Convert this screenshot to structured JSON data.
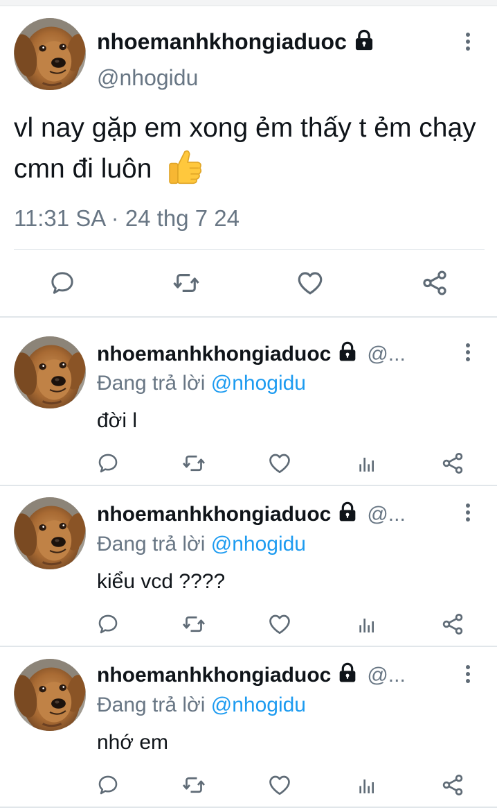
{
  "main_tweet": {
    "display_name": "nhoemanhkhongiaduoc",
    "handle": "@nhogidu",
    "text": "vl nay gặp em xong ẻm thấy t ẻm chạy cmn đi luôn",
    "emoji": "thumbs-up",
    "timestamp": "11:31 SA · 24 thg 7 24",
    "actions": [
      "reply-icon",
      "retweet-icon",
      "like-icon",
      "share-icon"
    ],
    "locked": true
  },
  "replies": [
    {
      "display_name": "nhoemanhkhongiaduoc",
      "handle_truncated": "@...",
      "replying_label": "Đang trả lời",
      "replying_to": "@nhogidu",
      "text": "đời l",
      "actions": [
        "reply-icon",
        "retweet-icon",
        "like-icon",
        "analytics-icon",
        "share-icon"
      ]
    },
    {
      "display_name": "nhoemanhkhongiaduoc",
      "handle_truncated": "@...",
      "replying_label": "Đang trả lời",
      "replying_to": "@nhogidu",
      "text": "kiểu vcd ????",
      "actions": [
        "reply-icon",
        "retweet-icon",
        "like-icon",
        "analytics-icon",
        "share-icon"
      ]
    },
    {
      "display_name": "nhoemanhkhongiaduoc",
      "handle_truncated": "@...",
      "replying_label": "Đang trả lời",
      "replying_to": "@nhogidu",
      "text": "nhớ em",
      "actions": [
        "reply-icon",
        "retweet-icon",
        "like-icon",
        "analytics-icon",
        "share-icon"
      ]
    }
  ],
  "colors": {
    "text": "#0f1419",
    "secondary": "#687684",
    "mention": "#1d9bf0",
    "divider": "#e1e6ea"
  }
}
